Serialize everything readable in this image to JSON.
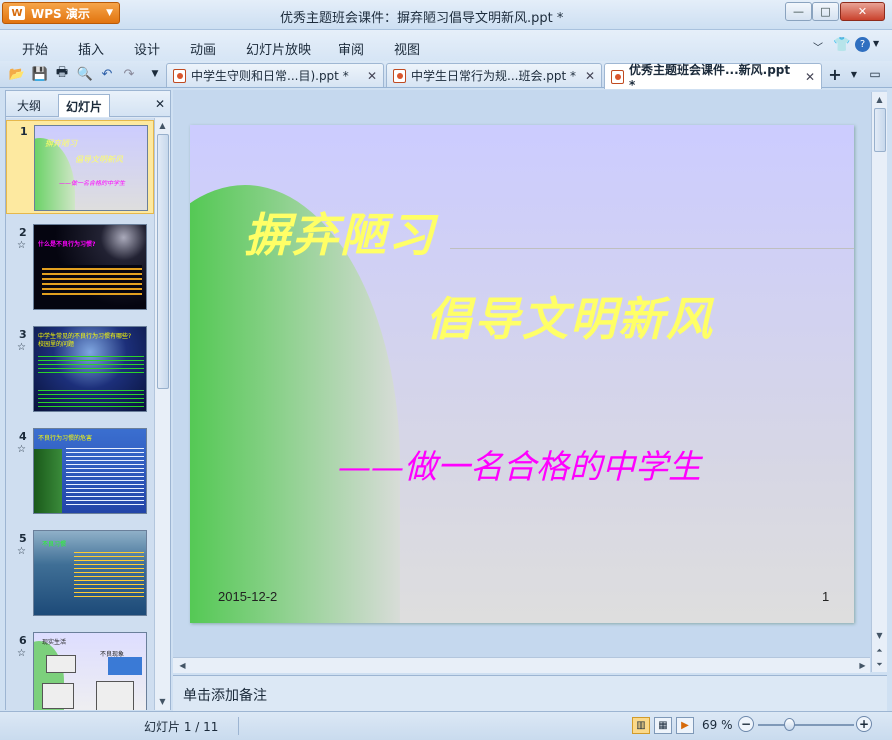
{
  "app": {
    "badge": "WPS 演示",
    "window_title": "优秀主题班会课件：摒弃陋习倡导文明新风.ppt *"
  },
  "window_controls": {
    "minimize": "—",
    "maximize": "□",
    "close": "✕"
  },
  "menu": [
    "开始",
    "插入",
    "设计",
    "动画",
    "幻灯片放映",
    "审阅",
    "视图"
  ],
  "doc_tabs": [
    {
      "label": "中学生守则和日常...目).ppt *",
      "active": false
    },
    {
      "label": "中学生日常行为规...班会.ppt *",
      "active": false
    },
    {
      "label": "优秀主题班会课件...新风.ppt *",
      "active": true
    }
  ],
  "pane": {
    "tab_outline": "大纲",
    "tab_slides": "幻灯片",
    "close": "✕"
  },
  "thumbnails": [
    {
      "num": "1",
      "star": "",
      "lines": [
        "摒弃陋习",
        "倡导文明新风",
        "——做一名合格的中学生"
      ],
      "style": "title"
    },
    {
      "num": "2",
      "star": "☆",
      "lines": [
        "什么是不良行为习惯?",
        "",
        "不良行为习惯...",
        "..."
      ],
      "style": "night"
    },
    {
      "num": "3",
      "star": "☆",
      "lines": [
        "中学生常见的不良行为习惯有哪些?",
        "校园里的问题"
      ],
      "style": "green"
    },
    {
      "num": "4",
      "star": "☆",
      "lines": [
        "不良行为习惯的危害"
      ],
      "style": "palm"
    },
    {
      "num": "5",
      "star": "☆",
      "lines": [
        "不良习惯"
      ],
      "style": "sea"
    },
    {
      "num": "6",
      "star": "☆",
      "lines": [
        "现实生活",
        "不良现象"
      ],
      "style": "cartoon"
    }
  ],
  "slide": {
    "title1": "摒弃陋习",
    "title2": "倡导文明新风",
    "subtitle": "——做一名合格的中学生",
    "date": "2015-12-2",
    "number": "1"
  },
  "notes_placeholder": "单击添加备注",
  "status": {
    "slide_counter": "幻灯片 1 / 11",
    "zoom": "69 %"
  },
  "colors": {
    "title": "#ffff66",
    "subtitle": "#ff00ff",
    "green": "#22c322"
  }
}
